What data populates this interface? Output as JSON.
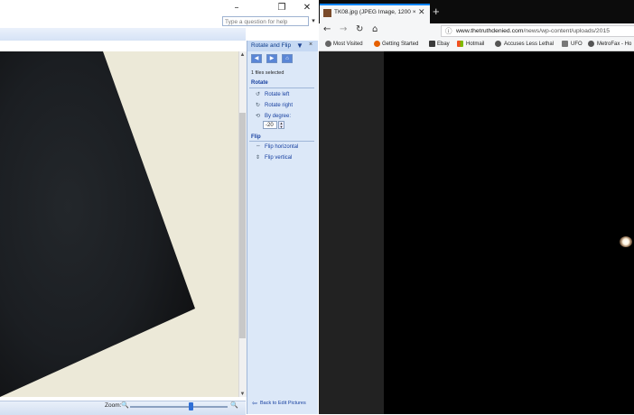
{
  "left_app": {
    "window_controls": [
      "–",
      "❐",
      "✕"
    ],
    "ask_placeholder": "Type a question for help",
    "ask_dropdown": "▾",
    "task_pane": {
      "title": "Rotate and Flip",
      "dropdown": "▼",
      "close": "×",
      "selection": "1 files selected",
      "rotate_heading": "Rotate",
      "rotate_left": "Rotate left",
      "rotate_right": "Rotate right",
      "by_degree": "By degree:",
      "degree_value": "-20",
      "flip_heading": "Flip",
      "flip_horizontal": "Flip horizontal",
      "flip_vertical": "Flip vertical",
      "back_link": "Back to Edit Pictures"
    },
    "status": {
      "zoom_label": "Zoom:",
      "zoom_level": 0.6
    },
    "colors": {
      "canvas": "#ece9d8",
      "pane": "#dce8f8",
      "link": "#1740a0"
    }
  },
  "browser": {
    "tab_title": "TK08.jpg (JPEG Image, 1200 ×",
    "tab_close": "✕",
    "new_tab": "+",
    "url_domain": "www.thetruthdenied.com",
    "url_path": "/news/wp-content/uploads/2015",
    "bookmarks": [
      {
        "label": "Most Visited",
        "icon": "gear-icon"
      },
      {
        "label": "Getting Started",
        "icon": "firefox-icon"
      },
      {
        "label": "Ebay",
        "icon": "shop-icon"
      },
      {
        "label": "Hotmail",
        "icon": "windows-icon"
      },
      {
        "label": "Accuses Less Lethal",
        "icon": "globe-icon"
      },
      {
        "label": "UFO",
        "icon": "folder-icon"
      },
      {
        "label": "MetroFax - Ho",
        "icon": "globe-icon"
      }
    ],
    "colors": {
      "accent": "#0a84ff",
      "viewer_bg": "#000000"
    }
  }
}
